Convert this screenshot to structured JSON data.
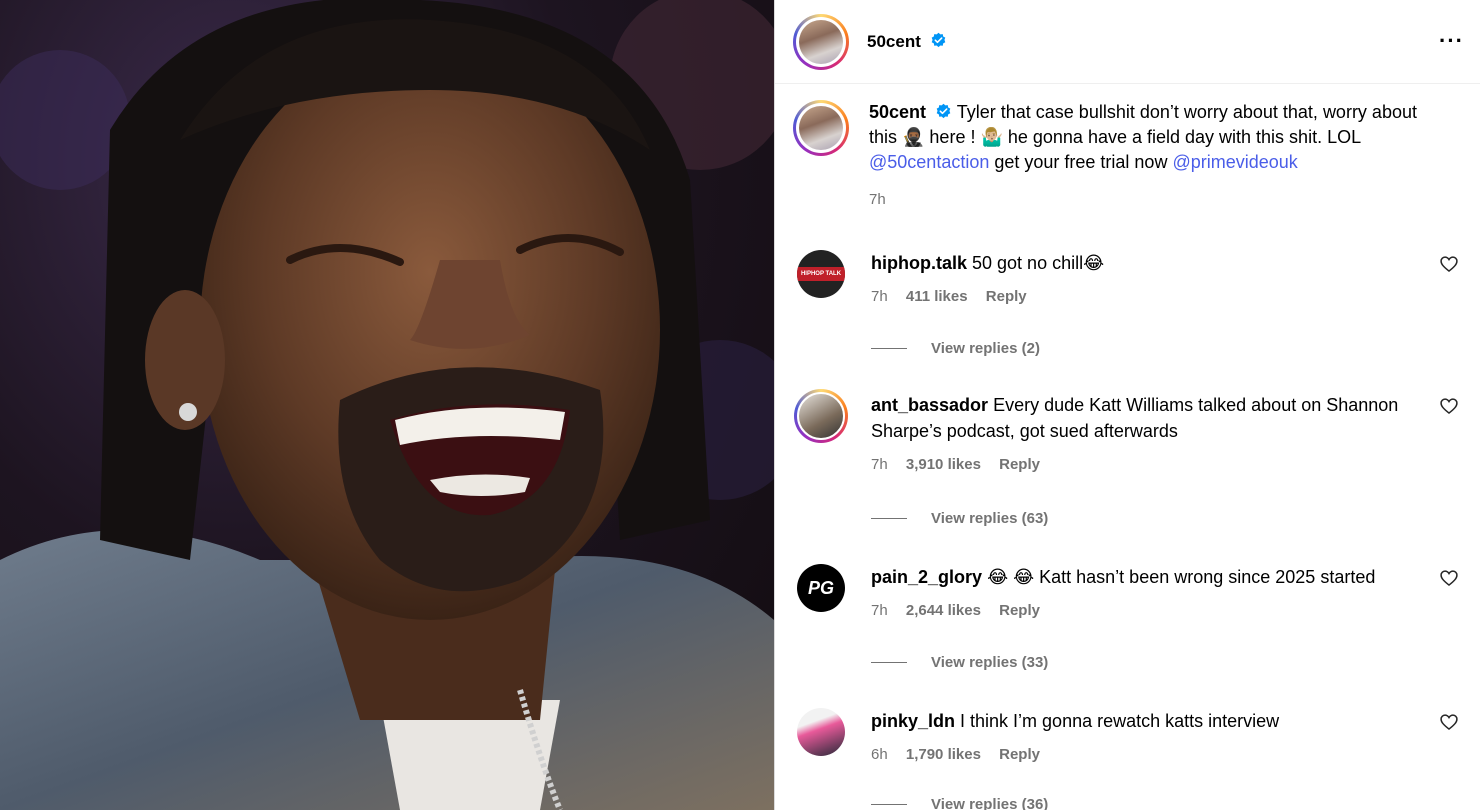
{
  "post": {
    "username": "50cent",
    "menu_label": "···",
    "caption": {
      "username": "50cent",
      "text_part1": "Tyler that case bullshit don’t worry about that, worry about this 🥷🏾 here ! 🤷🏼‍♂️ he gonna have a field day with this shit. LOL ",
      "mention1": "@50centaction",
      "text_part2": " get your free trial now ",
      "mention2": "@primevideouk",
      "time": "7h"
    }
  },
  "comments": [
    {
      "username": "hiphop.talk",
      "text": "50 got no chill😂",
      "time": "7h",
      "likes": "411 likes",
      "reply": "Reply",
      "view_replies": "View replies (2)"
    },
    {
      "username": "ant_bassador",
      "text": "Every dude Katt Williams talked about on Shannon Sharpe’s podcast, got sued afterwards",
      "time": "7h",
      "likes": "3,910 likes",
      "reply": "Reply",
      "view_replies": "View replies (63)"
    },
    {
      "username": "pain_2_glory",
      "text": "😂 😂  Katt hasn’t been wrong since 2025 started",
      "time": "7h",
      "likes": "2,644 likes",
      "reply": "Reply",
      "view_replies": "View replies (33)"
    },
    {
      "username": "pinky_ldn",
      "text": "I think I’m gonna rewatch katts interview",
      "time": "6h",
      "likes": "1,790 likes",
      "reply": "Reply",
      "view_replies": "View replies (36)"
    }
  ],
  "avatar_labels": {
    "hiphop": "HIPHOP TALK",
    "pain": "PG"
  },
  "colors": {
    "mention": "#4a5de8",
    "verified": "#0095f6",
    "muted": "#737373"
  }
}
